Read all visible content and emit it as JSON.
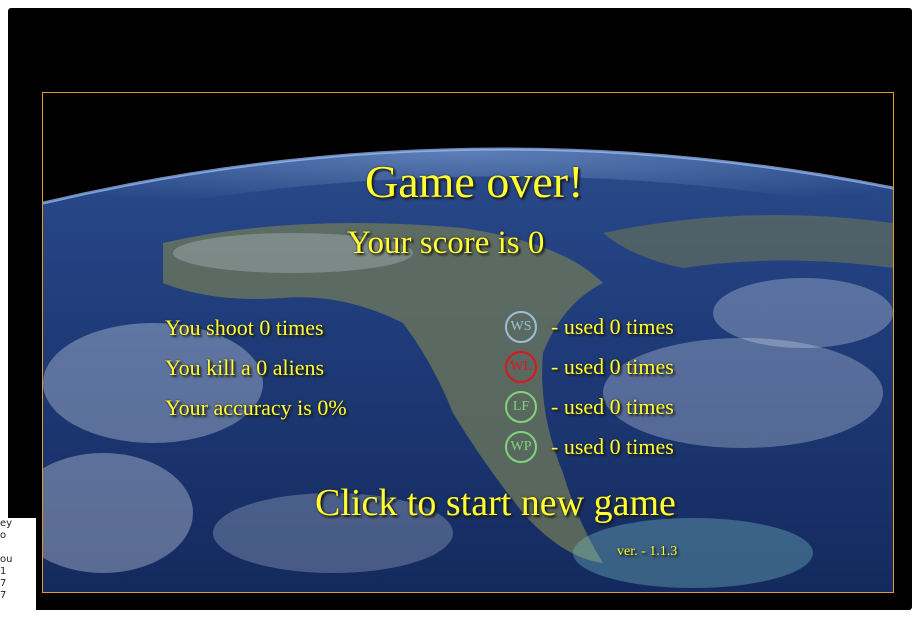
{
  "game": {
    "title": "Game over!",
    "score_text": "Your score is 0",
    "stats": {
      "shots": "You shoot 0 times",
      "kills": "You kill a 0 aliens",
      "accuracy": "Your accuracy is 0%"
    },
    "powerups": [
      {
        "code": "WS",
        "label": "- used 0 times",
        "color": "#9ec0d8"
      },
      {
        "code": "WL",
        "label": "- used 0 times",
        "color": "#e0141e"
      },
      {
        "code": "LF",
        "label": "- used 0 times",
        "color": "#7fd67a"
      },
      {
        "code": "WP",
        "label": "- used 0 times",
        "color": "#7fd67a"
      }
    ],
    "new_game": "Click to start new game",
    "version": "ver. - 1.1.3"
  },
  "colors": {
    "text": "#ffff33",
    "frame_border": "#e39b2a",
    "window_bg": "#000000"
  },
  "side_widget": {
    "lines": [
      "ey",
      "o",
      "",
      "ou",
      "1",
      "7",
      "7"
    ]
  }
}
